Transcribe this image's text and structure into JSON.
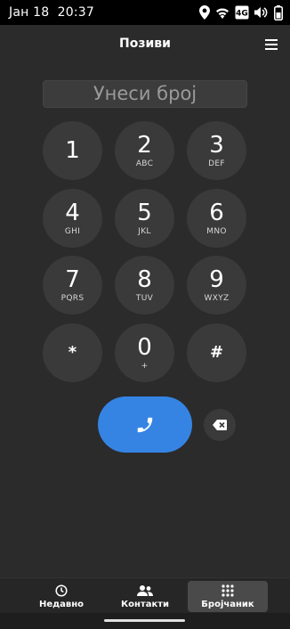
{
  "status": {
    "date": "Јан 18",
    "time": "20:37",
    "network": "4G"
  },
  "header": {
    "title": "Позиви"
  },
  "dialer": {
    "placeholder": "Унеси број",
    "keys": [
      {
        "digit": "1",
        "letters": ""
      },
      {
        "digit": "2",
        "letters": "ABC"
      },
      {
        "digit": "3",
        "letters": "DEF"
      },
      {
        "digit": "4",
        "letters": "GHI"
      },
      {
        "digit": "5",
        "letters": "JKL"
      },
      {
        "digit": "6",
        "letters": "MNO"
      },
      {
        "digit": "7",
        "letters": "PQRS"
      },
      {
        "digit": "8",
        "letters": "TUV"
      },
      {
        "digit": "9",
        "letters": "WXYZ"
      },
      {
        "digit": "*",
        "letters": ""
      },
      {
        "digit": "0",
        "letters": "+"
      },
      {
        "digit": "#",
        "letters": ""
      }
    ]
  },
  "tabs": [
    {
      "label": "Недавно",
      "icon": "clock-icon",
      "active": false
    },
    {
      "label": "Контакти",
      "icon": "contacts-icon",
      "active": false
    },
    {
      "label": "Бројчаник",
      "icon": "dialpad-icon",
      "active": true
    }
  ],
  "colors": {
    "accent": "#3584e4",
    "background": "#2b2b2b",
    "key": "#3a3a3a"
  }
}
